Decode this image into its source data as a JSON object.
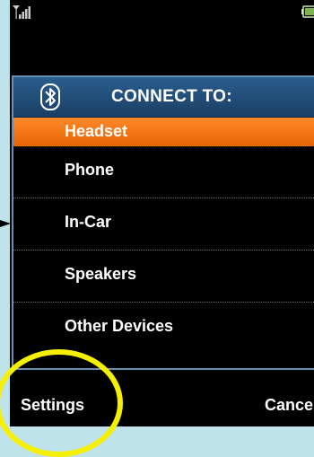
{
  "dialog": {
    "title": "CONNECT TO:",
    "icon": "bluetooth-icon",
    "items": [
      {
        "label": "Headset",
        "selected": true
      },
      {
        "label": "Phone",
        "selected": false
      },
      {
        "label": "In-Car",
        "selected": false
      },
      {
        "label": "Speakers",
        "selected": false
      },
      {
        "label": "Other Devices",
        "selected": false
      }
    ]
  },
  "softkeys": {
    "left": "Settings",
    "right": "Cancel"
  },
  "status_bar": {
    "icons": [
      "signal-icon",
      "battery-icon"
    ]
  },
  "colors": {
    "selection": "#f07410",
    "header": "#2b5d8d",
    "highlight_circle": "#f5ef00",
    "background": "#bfe3ea"
  }
}
